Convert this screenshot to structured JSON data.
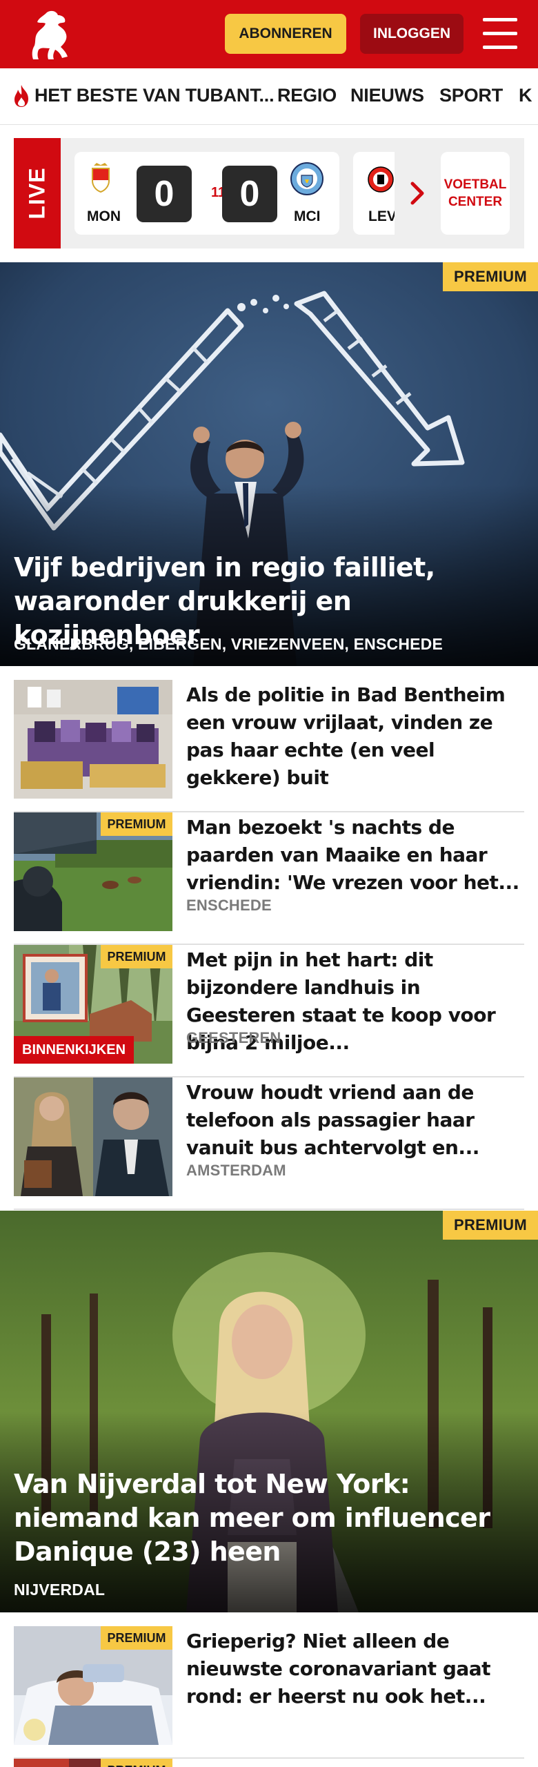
{
  "header": {
    "subscribe_label": "ABONNEREN",
    "login_label": "INLOGGEN",
    "brand_color": "#d10a11",
    "subscribe_color": "#f7c844"
  },
  "nav": {
    "items": [
      "HET BESTE VAN TUBANT...",
      "REGIO",
      "NIEUWS",
      "SPORT",
      "K"
    ],
    "flame_icon": "flame-icon"
  },
  "live": {
    "label": "LIVE",
    "match": {
      "home": "MON",
      "home_score": "0",
      "minute": "11'",
      "away_score": "0",
      "away": "MCI"
    },
    "next_team": "LEV",
    "voetbal_center": [
      "VOETBAL",
      "CENTER"
    ]
  },
  "hero1": {
    "premium": "PREMIUM",
    "title": "Vijf bedrijven in regio failliet, waaronder drukkerij en kozijnenboer",
    "location": "GLANERBRUG, EIBERGEN, VRIEZENVEEN, ENSCHEDE"
  },
  "articles": [
    {
      "title": "Als de politie in Bad Bentheim een vrouw vrijlaat, vinden ze pas haar echte (en veel gekkere) buit",
      "location": ""
    },
    {
      "premium": "PREMIUM",
      "title": "Man bezoekt 's nachts de paarden van Maaike en haar vriendin: 'We vrezen voor het...",
      "location": "ENSCHEDE"
    },
    {
      "premium": "PREMIUM",
      "badge": "BINNENKIJKEN",
      "title": "Met pijn in het hart: dit bijzondere landhuis in Geesteren staat te koop voor bijna 2 miljoe...",
      "location": "GEESTEREN"
    },
    {
      "title": "Vrouw houdt vriend aan de telefoon als passagier haar vanuit bus achtervolgt en...",
      "location": "AMSTERDAM"
    }
  ],
  "hero2": {
    "premium": "PREMIUM",
    "title": "Van Nijverdal tot New York: niemand kan meer om influencer Danique (23) heen",
    "location": "NIJVERDAL"
  },
  "article5": {
    "premium": "PREMIUM",
    "title": "Grieperig? Niet alleen de nieuwste coronavariant gaat rond: er heerst nu ook het...",
    "location": ""
  },
  "article6": {
    "premium": "PREMIUM"
  }
}
